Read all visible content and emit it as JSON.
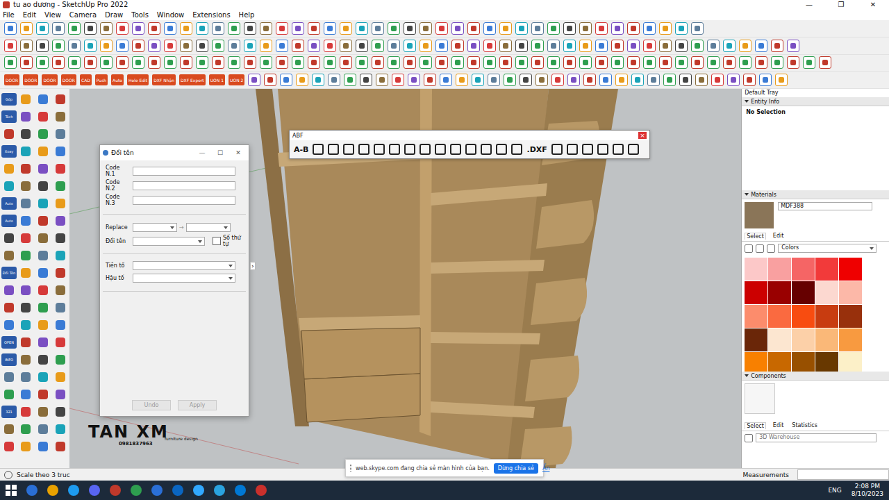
{
  "window": {
    "title": "tu ao dương - SketchUp Pro 2022",
    "controls": [
      "—",
      "❐",
      "✕"
    ]
  },
  "menu": [
    "File",
    "Edit",
    "View",
    "Camera",
    "Draw",
    "Tools",
    "Window",
    "Extensions",
    "Help"
  ],
  "toolbar_labels": [
    "DOOR",
    "DOOR",
    "DOOR",
    "DOOR",
    "CAD",
    "Push",
    "Auto",
    "Hole Edit",
    "DXF Nhận",
    "DXF Export",
    "UON 1",
    "UON 2"
  ],
  "left_labels": [
    "Góp",
    "Tách",
    "Xoay",
    "Auto",
    "Auto",
    "Đổi Tên",
    "OPEN",
    "INFO",
    "321"
  ],
  "abf": {
    "title": "ABF",
    "close": "×",
    "buttons": [
      "A-B",
      ".DXF"
    ]
  },
  "rename_dialog": {
    "title": "Đổi tên",
    "controls": [
      "—",
      "☐",
      "✕"
    ],
    "code_fields": [
      {
        "label": "Code N.1",
        "value": ""
      },
      {
        "label": "Code N.2",
        "value": ""
      },
      {
        "label": "Code N.3",
        "value": ""
      }
    ],
    "replace_label": "Replace",
    "replace_arrow": "→",
    "rename_label": "Đổi tên",
    "sequence": {
      "label": "Số thứ tự",
      "checked": false
    },
    "prefix_label": "Tiền tố",
    "suffix_label": "Hậu tố",
    "expand": "›",
    "buttons": [
      {
        "label": "Undo",
        "disabled": true
      },
      {
        "label": "Apply",
        "disabled": true
      }
    ]
  },
  "watermark": {
    "brand": "TAN XM",
    "phone": "0981837963",
    "tag": "furniture design"
  },
  "tray": {
    "title": "Default Tray",
    "entity_info": {
      "title": "Entity Info",
      "status": "No Selection"
    },
    "materials": {
      "title": "Materials",
      "name": "MDF388",
      "tabs": [
        {
          "label": "Select",
          "selected": true
        },
        {
          "label": "Edit",
          "selected": false
        }
      ],
      "library": "Colors",
      "swatches": [
        {
          "color": "#fcc8c8"
        },
        {
          "color": "#f9a0a0"
        },
        {
          "color": "#f56565"
        },
        {
          "color": "#f23a3a"
        },
        {
          "color": "#ef0000"
        },
        {
          "color": "#cc0000"
        },
        {
          "color": "#990000"
        },
        {
          "color": "#660000"
        },
        {
          "color": "#fcd8d0"
        },
        {
          "color": "#fcb8a8"
        },
        {
          "color": "#fc8c6c"
        },
        {
          "color": "#fa6a40"
        },
        {
          "color": "#f84c10"
        },
        {
          "color": "#c83c10"
        },
        {
          "color": "#98300c"
        },
        {
          "color": "#6a2608"
        },
        {
          "color": "#fce6d0"
        },
        {
          "color": "#fcd0a8"
        },
        {
          "color": "#fab878"
        },
        {
          "color": "#f89a40"
        },
        {
          "color": "#f88000"
        },
        {
          "color": "#c86800"
        },
        {
          "color": "#985000"
        },
        {
          "color": "#683800"
        },
        {
          "color": "#fcf0c8"
        }
      ]
    },
    "components": {
      "title": "Components",
      "tabs": [
        {
          "label": "Select",
          "selected": true
        },
        {
          "label": "Edit",
          "selected": false
        },
        {
          "label": "Statistics",
          "selected": false
        }
      ],
      "search_placeholder": "3D Warehouse"
    }
  },
  "measurements": {
    "label": "Measurements"
  },
  "status_bar": {
    "text": "Scale theo 3 truc"
  },
  "share_bar": {
    "message": "web.skype.com đang chia sẻ màn hình của bạn.",
    "stop": "Dừng chia sẻ",
    "hide": "Ẩn"
  },
  "taskbar": {
    "language": "ENG",
    "time": "2:08 PM",
    "date": "8/10/2023"
  }
}
